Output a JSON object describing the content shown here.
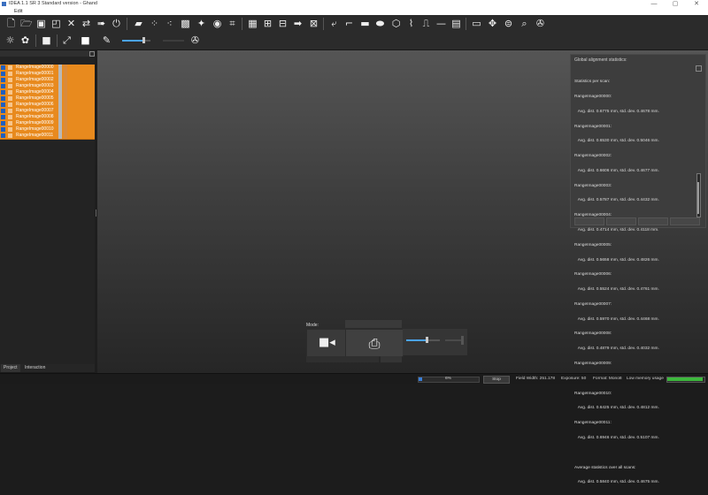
{
  "window": {
    "title": "IDEA 1.1 SR 3 Standard version - Ghand",
    "controls": [
      "—",
      "▢",
      "✕"
    ]
  },
  "menu": {
    "items": [
      "Edit"
    ]
  },
  "toolbar1": {
    "icons": [
      "new-file-icon",
      "open-folder-icon",
      "save-icon",
      "save-as-icon",
      "delete-icon",
      "import-icon",
      "export-icon",
      "power-icon",
      "scan-tool-icon",
      "align-icon",
      "points-icon",
      "pattern-icon",
      "transform-icon",
      "merge-icon",
      "simplify-icon",
      "grid-icon",
      "grid-select-icon",
      "stack-icon",
      "arrow-right-icon",
      "layers-icon",
      "curve-icon",
      "corner-icon",
      "rectangle-icon",
      "ellipse-icon",
      "polygon-icon",
      "polyline-icon",
      "line-step-icon",
      "line-icon",
      "panel-icon",
      "window-icon",
      "move-icon",
      "disc-icon",
      "search-icon",
      "wrench-icon"
    ]
  },
  "toolbar2": {
    "icons": [
      "light-icon",
      "palette-icon",
      "square-icon",
      "expand-icon",
      "white-square-icon",
      "color-picker-icon",
      "slider-icon",
      "wrench-icon"
    ],
    "slider_level": 0.75
  },
  "layer_panel": {
    "items": [
      "RangeImage00000",
      "RangeImage00001",
      "RangeImage00002",
      "RangeImage00003",
      "RangeImage00004",
      "RangeImage00005",
      "RangeImage00006",
      "RangeImage00007",
      "RangeImage00008",
      "RangeImage00009",
      "RangeImage00010",
      "RangeImage00011"
    ],
    "tabs": [
      "Project",
      "Interaction"
    ]
  },
  "stats_panel": {
    "title": "Global alignment statistics:",
    "lines": [
      "Statistics per scan:",
      "RangeImage00000:",
      "   Avg. dist. 0.6775 mm, std. dev. 0.4678 mm.",
      "RangeImage00001:",
      "   Avg. dist. 0.6530 mm, std. dev. 0.5046 mm.",
      "RangeImage00002:",
      "   Avg. dist. 0.6606 mm, std. dev. 0.4677 mm.",
      "RangeImage00003:",
      "   Avg. dist. 0.5787 mm, std. dev. 0.4432 mm.",
      "RangeImage00004:",
      "   Avg. dist. 0.4714 mm, std. dev. 0.4118 mm.",
      "RangeImage00005:",
      "   Avg. dist. 0.5658 mm, std. dev. 0.4826 mm.",
      "RangeImage00006:",
      "   Avg. dist. 0.5524 mm, std. dev. 0.4761 mm.",
      "RangeImage00007:",
      "   Avg. dist. 0.5970 mm, std. dev. 0.4468 mm.",
      "RangeImage00008:",
      "   Avg. dist. 0.4879 mm, std. dev. 0.4032 mm.",
      "RangeImage00009:",
      "   Avg. dist. 0.5468 mm, std. dev. 0.4380 mm.",
      "RangeImage00010:",
      "   Avg. dist. 0.6425 mm, std. dev. 0.4812 mm.",
      "RangeImage00011:",
      "   Avg. dist. 0.6946 mm, std. dev. 0.5107 mm.",
      "",
      "Average statistics over all scans:",
      "   Avg. dist. 0.5840 mm, std. dev. 0.4675 mm."
    ]
  },
  "mode_panel": {
    "label": "Mode:",
    "buttons": [
      "video-camera-icon",
      "camera-icon"
    ],
    "slider_level": 0.6
  },
  "statusbar": {
    "progress_label": "6%",
    "progress": 0.06,
    "stop_label": "Stop",
    "field_width": "Field Width: 251.178",
    "exposure": "Exposure: 50",
    "format": "Format: Mono8",
    "memory": "Low memory usage",
    "memory_level": 0.95,
    "memory_color": "#3db83d"
  }
}
